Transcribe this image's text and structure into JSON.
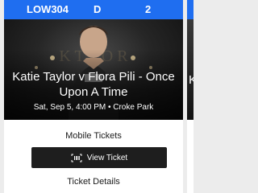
{
  "ticket": {
    "section": "LOW304",
    "row": "D",
    "seat": "2",
    "event_title": "Katie Taylor v Flora Pili - Once Upon A Time",
    "event_meta": "Sat, Sep 5, 4:00 PM • Croke Park",
    "mobile_tickets_heading": "Mobile Tickets",
    "view_ticket_label": "View Ticket",
    "view_ticket_icon": "barcode-scan-icon",
    "ticket_details_heading": "Ticket Details"
  },
  "next_ticket": {
    "title_initial": "K"
  },
  "colors": {
    "seat_bar": "#1f6ef0",
    "button": "#1e1e1e",
    "background": "#ececec"
  }
}
